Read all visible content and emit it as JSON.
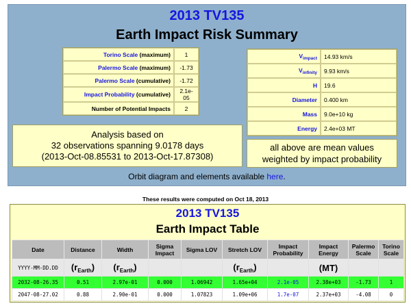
{
  "summary": {
    "title": "2013 TV135",
    "subtitle": "Earth Impact Risk Summary",
    "left_params": [
      {
        "label": "Torino Scale",
        "suffix": " (maximum)",
        "value": "1"
      },
      {
        "label": "Palermo Scale",
        "suffix": " (maximum)",
        "value": "-1.73"
      },
      {
        "label": "Palermo Scale",
        "suffix": " (cumulative)",
        "value": "-1.72"
      },
      {
        "label": "Impact Probability",
        "suffix": " (cumulative)",
        "value": "2.1e-05"
      },
      {
        "label": "Number of Potential Impacts",
        "suffix": "",
        "value": "2"
      }
    ],
    "right_params": [
      {
        "label": "V",
        "sub": "impact",
        "value": "14.93 km/s"
      },
      {
        "label": "V",
        "sub": "infinity",
        "value": "9.93 km/s"
      },
      {
        "label": "H",
        "sub": "",
        "value": "19.6"
      },
      {
        "label": "Diameter",
        "sub": "",
        "value": "0.400 km"
      },
      {
        "label": "Mass",
        "sub": "",
        "value": "9.0e+10 kg"
      },
      {
        "label": "Energy",
        "sub": "",
        "value": "2.4e+03 MT"
      }
    ],
    "analysis": {
      "line1": "Analysis based on",
      "line2": "32 observations spanning 9.0178 days",
      "line3": "(2013-Oct-08.85531 to 2013-Oct-17.87308)"
    },
    "weighted": {
      "line1": "all above are mean values",
      "line2": "weighted by impact probability"
    },
    "orbit": {
      "text": "Orbit diagram and elements available ",
      "link": "here",
      "end": "."
    }
  },
  "computed_note": "These results were computed on Oct 18, 2013",
  "impact_table": {
    "title": "2013 TV135",
    "subtitle": "Earth Impact Table",
    "headers": [
      "Date",
      "Distance",
      "Width",
      "Sigma Impact",
      "Sigma LOV",
      "Stretch LOV",
      "Impact Probability",
      "Impact Energy",
      "Palermo Scale",
      "Torino Scale"
    ],
    "units": {
      "date_format": "YYYY-MM-DD.DD",
      "r_main": "(r",
      "r_sub": "Earth",
      "r_close": ")",
      "energy": "(MT)"
    },
    "rows": [
      [
        "2032-08-26.35",
        "0.51",
        "2.97e-01",
        "0.000",
        "1.06942",
        "1.65e+04",
        "2.1e-05",
        "2.38e+03",
        "-1.73",
        "1"
      ],
      [
        "2047-08-27.02",
        "0.88",
        "2.90e-01",
        "0.000",
        "1.07823",
        "1.09e+06",
        "1.7e-07",
        "2.37e+03",
        "-4.08",
        "0"
      ]
    ],
    "highlight_color": "#33ff33"
  }
}
